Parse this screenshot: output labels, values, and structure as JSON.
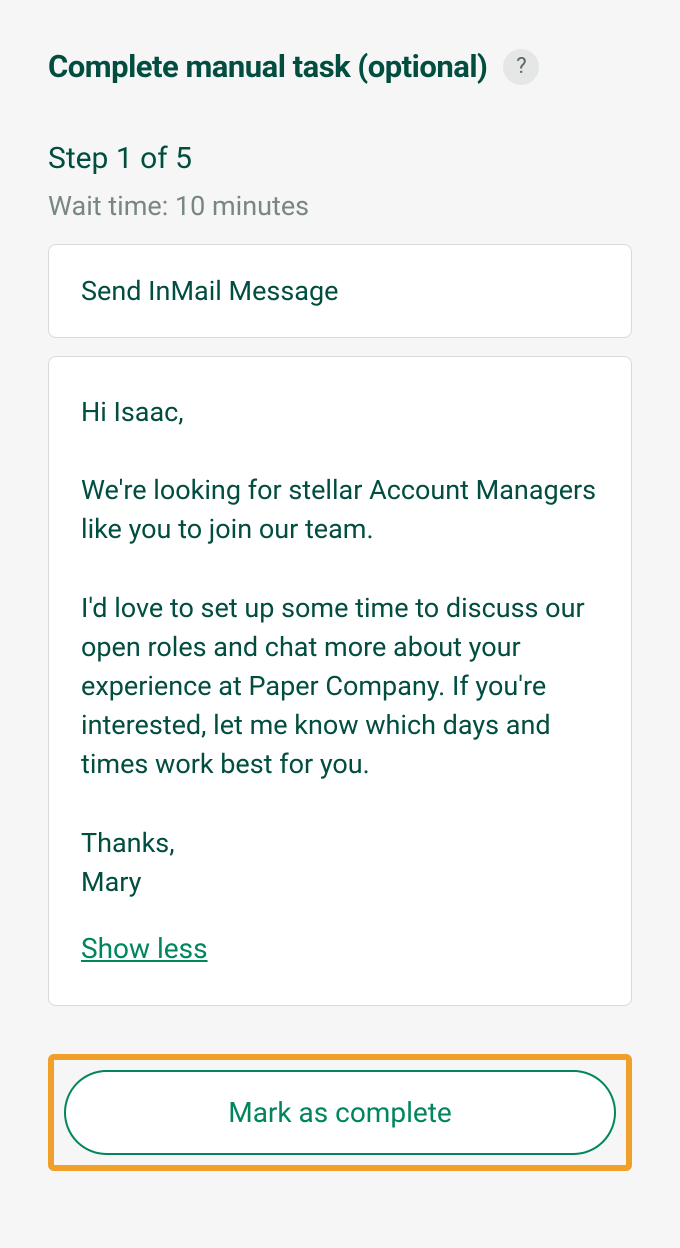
{
  "header": {
    "title": "Complete manual task (optional)",
    "help": "?"
  },
  "step": {
    "label": "Step 1 of 5",
    "wait_time": "Wait time: 10 minutes"
  },
  "subject": "Send InMail Message",
  "message": "Hi Isaac,\n\nWe're looking for stellar Account Managers like you to join our team.\n\nI'd love to set up some time to discuss our open roles and chat more about your experience at Paper Company. If you're interested, let me know which days and times work best for you.\n\nThanks,\nMary",
  "show_less": "Show less",
  "mark_complete": "Mark as complete"
}
